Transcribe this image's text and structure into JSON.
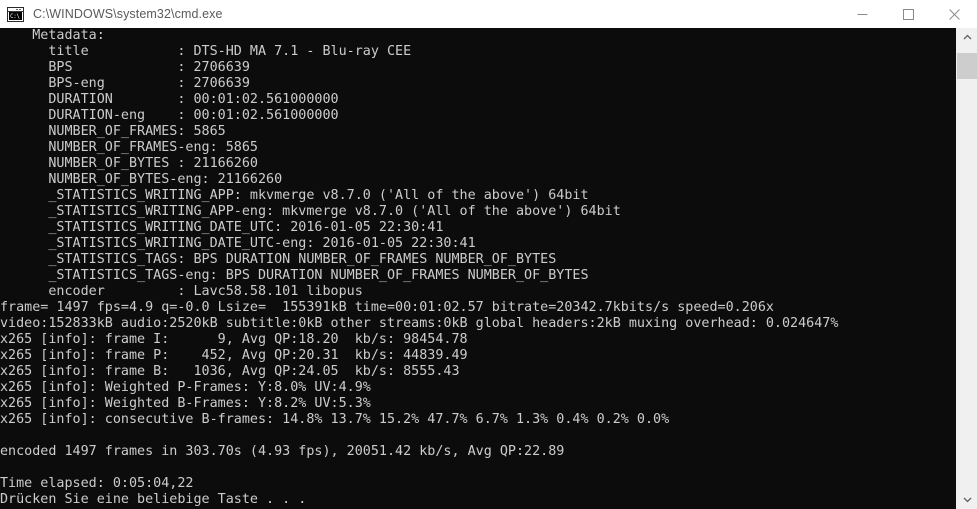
{
  "window": {
    "title": "C:\\WINDOWS\\system32\\cmd.exe",
    "icon_name": "cmd-console-icon",
    "icon_text": "C:\\",
    "titlebar_bg": "#ffffff",
    "titlebar_fg": "#5a5a5a",
    "console_bg": "#0c0c0c",
    "console_fg": "#cccccc"
  },
  "controls": {
    "minimize_label": "Minimize",
    "maximize_label": "Maximize",
    "close_label": "Close"
  },
  "scrollbar": {
    "up_label": "Scroll up",
    "down_label": "Scroll down",
    "thumb_label": "Scrollbar thumb"
  },
  "console": {
    "lines": [
      "    Metadata:",
      "      title           : DTS-HD MA 7.1 - Blu-ray CEE",
      "      BPS             : 2706639",
      "      BPS-eng         : 2706639",
      "      DURATION        : 00:01:02.561000000",
      "      DURATION-eng    : 00:01:02.561000000",
      "      NUMBER_OF_FRAMES: 5865",
      "      NUMBER_OF_FRAMES-eng: 5865",
      "      NUMBER_OF_BYTES : 21166260",
      "      NUMBER_OF_BYTES-eng: 21166260",
      "      _STATISTICS_WRITING_APP: mkvmerge v8.7.0 ('All of the above') 64bit",
      "      _STATISTICS_WRITING_APP-eng: mkvmerge v8.7.0 ('All of the above') 64bit",
      "      _STATISTICS_WRITING_DATE_UTC: 2016-01-05 22:30:41",
      "      _STATISTICS_WRITING_DATE_UTC-eng: 2016-01-05 22:30:41",
      "      _STATISTICS_TAGS: BPS DURATION NUMBER_OF_FRAMES NUMBER_OF_BYTES",
      "      _STATISTICS_TAGS-eng: BPS DURATION NUMBER_OF_FRAMES NUMBER_OF_BYTES",
      "      encoder         : Lavc58.58.101 libopus",
      "frame= 1497 fps=4.9 q=-0.0 Lsize=  155391kB time=00:01:02.57 bitrate=20342.7kbits/s speed=0.206x",
      "video:152833kB audio:2520kB subtitle:0kB other streams:0kB global headers:2kB muxing overhead: 0.024647%",
      "x265 [info]: frame I:      9, Avg QP:18.20  kb/s: 98454.78",
      "x265 [info]: frame P:    452, Avg QP:20.31  kb/s: 44839.49",
      "x265 [info]: frame B:   1036, Avg QP:24.05  kb/s: 8555.43",
      "x265 [info]: Weighted P-Frames: Y:8.0% UV:4.9%",
      "x265 [info]: Weighted B-Frames: Y:8.2% UV:5.3%",
      "x265 [info]: consecutive B-frames: 14.8% 13.7% 15.2% 47.7% 6.7% 1.3% 0.4% 0.2% 0.0%",
      "",
      "encoded 1497 frames in 303.70s (4.93 fps), 20051.42 kb/s, Avg QP:22.89",
      "",
      "Time elapsed: 0:05:04,22",
      "Drücken Sie eine beliebige Taste . . ."
    ]
  }
}
